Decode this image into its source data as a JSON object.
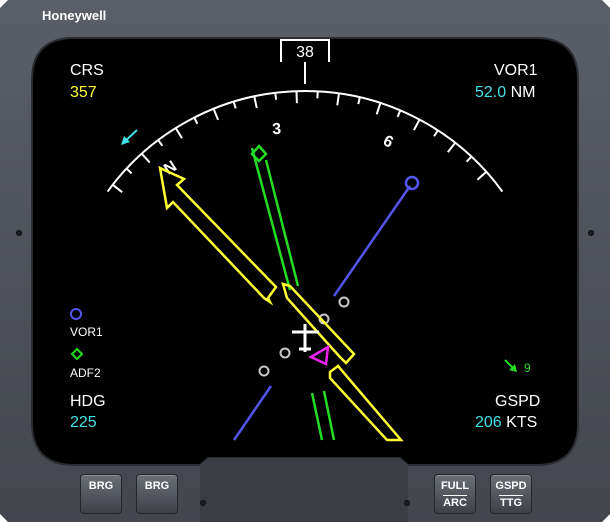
{
  "brand": "Honeywell",
  "course": {
    "label": "CRS",
    "value": "357"
  },
  "nav_source": {
    "label": "VOR1",
    "distance": "52.0",
    "unit": "NM"
  },
  "heading": {
    "label": "HDG",
    "value": "225"
  },
  "ground_speed": {
    "label": "GSPD",
    "value": "206",
    "unit": "KTS"
  },
  "heading_box": "38",
  "compass_labels": {
    "n": "N",
    "three": "3",
    "six": "6"
  },
  "legend": {
    "vor": "VOR1",
    "adf": "ADF2"
  },
  "wind": "9",
  "buttons": {
    "brg_circle": "BRG",
    "brg_diamond": "BRG",
    "full_arc_top": "FULL",
    "full_arc_bottom": "ARC",
    "gspd_top": "GSPD",
    "gspd_bottom": "TTG"
  },
  "colors": {
    "course_pointer": "#ffff33",
    "adf_needle": "#22dd22",
    "vor_needle": "#5555ee",
    "aircraft_symbol": "#ffffff",
    "fix_marker": "#ee22ee",
    "digits_cyan": "#40e0e6"
  }
}
